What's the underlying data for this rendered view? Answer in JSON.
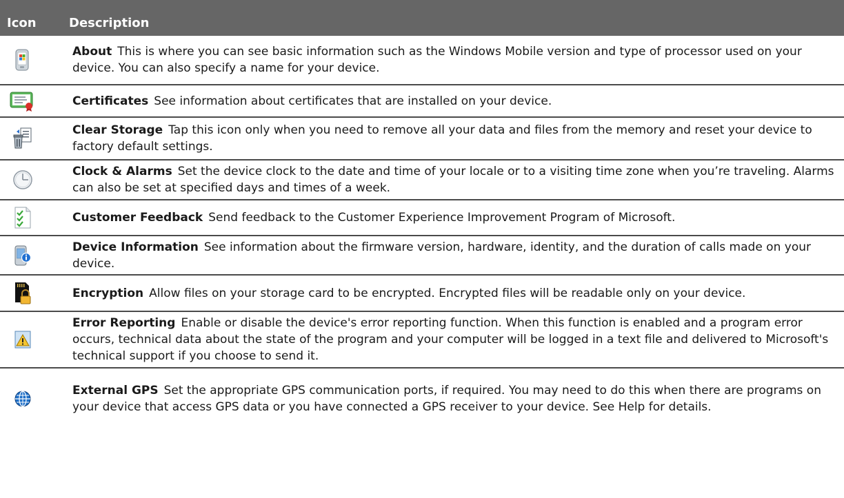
{
  "header": {
    "icon_label": "Icon",
    "description_label": "Description"
  },
  "rows": [
    {
      "icon": "about-phone-icon",
      "title": "About",
      "text": "This is where you can see basic information such as the Windows Mobile version and type of processor used on your device. You can also specify a name for your device."
    },
    {
      "icon": "certificate-icon",
      "title": "Certificates",
      "text": "See information about certificates that are installed on your device."
    },
    {
      "icon": "clear-storage-icon",
      "title": "Clear Storage",
      "text": "Tap this icon only when you need to remove all your data and files from the memory and reset your device to factory default settings."
    },
    {
      "icon": "clock-icon",
      "title": "Clock & Alarms",
      "text": "Set the device clock to the date and time of your locale or to a visiting time zone when you’re traveling. Alarms can also be set at specified days and times of a week."
    },
    {
      "icon": "checklist-icon",
      "title": "Customer Feedback",
      "text": "Send feedback to the Customer Experience Improvement Program of Microsoft."
    },
    {
      "icon": "device-info-icon",
      "title": "Device Information",
      "text": "See information about the firmware version, hardware, identity, and the duration of calls made on your device."
    },
    {
      "icon": "sd-card-lock-icon",
      "title": "Encryption",
      "text": "Allow files on your storage card to be encrypted. Encrypted files will be readable only on your device."
    },
    {
      "icon": "error-warning-icon",
      "title": "Error Reporting",
      "text": "Enable or disable the device's error reporting function. When this function is enabled and a program error occurs, technical data about the state of the program and your computer will be logged in a text file and delivered to Microsoft's technical support if you choose to send it."
    },
    {
      "icon": "globe-icon",
      "title": "External GPS",
      "text": "Set the appropriate GPS communication ports, if required. You may need to do this when there are programs on your device that access GPS data or you have connected a GPS receiver to your device. See Help for details."
    }
  ]
}
